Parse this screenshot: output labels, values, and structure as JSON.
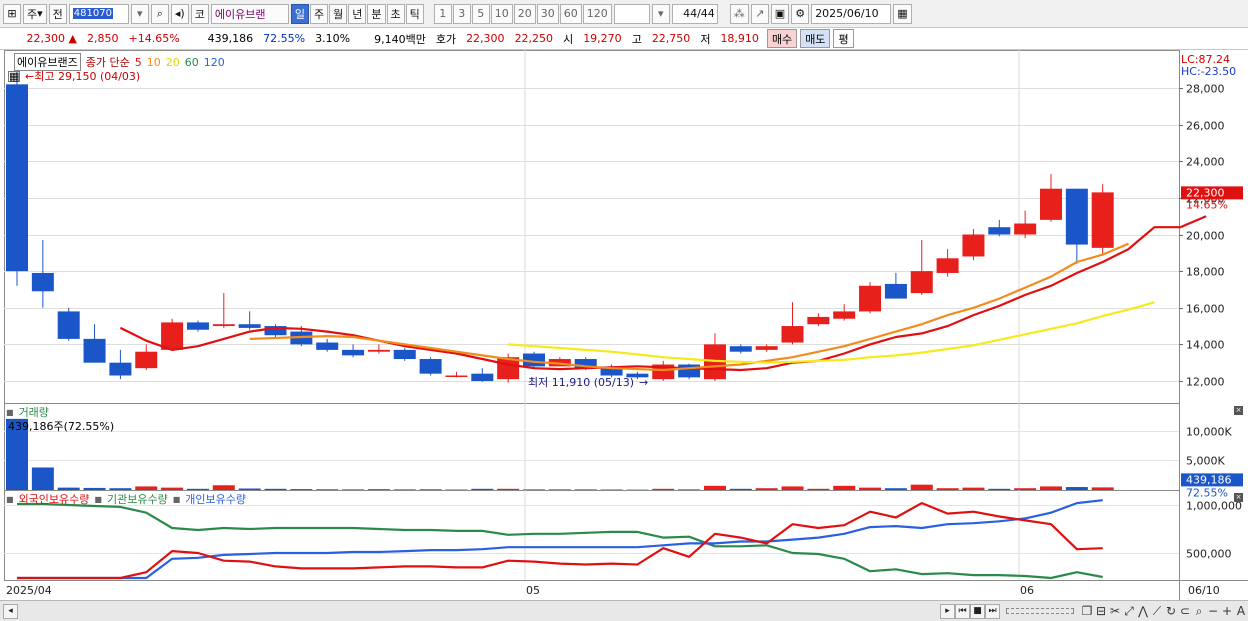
{
  "toolbar": {
    "market_label": "주",
    "prev_label": "전",
    "stock_code": "481070",
    "exchange_label": "코",
    "stock_name": "에이유브랜",
    "periods": [
      "일",
      "주",
      "월",
      "년",
      "분",
      "초",
      "틱"
    ],
    "selected_period": "일",
    "intervals": [
      "1",
      "3",
      "5",
      "10",
      "20",
      "30",
      "60",
      "120"
    ],
    "counter": "44/44",
    "date": "2025/06/10"
  },
  "quote": {
    "price": "22,300",
    "change_arrow": "▲",
    "change": "2,850",
    "change_pct": "+14.65%",
    "volume": "439,186",
    "volume_ratio": "72.55%",
    "turnover": "3.10%",
    "amount": "9,140백만",
    "ask_label": "호가",
    "ask": "22,300",
    "bid": "22,250",
    "open_label": "시",
    "open": "19,270",
    "high_label": "고",
    "high": "22,750",
    "low_label": "저",
    "low": "18,910",
    "buy_label": "매수",
    "sell_label": "매도",
    "eval_label": "평"
  },
  "price_panel": {
    "name": "에이유브랜즈",
    "ma_label": "종가 단순",
    "ma_periods": [
      "5",
      "10",
      "20",
      "60",
      "120"
    ],
    "high_annotation": "←최고 29,150 (04/03)",
    "low_annotation": "최저 11,910 (05/13)",
    "lc_label": "LC:87.24",
    "hc_label": "HC:-23.50",
    "current_price_tag": "22,300",
    "current_pct_tag": "14.65%",
    "y_ticks": [
      "28,000",
      "26,000",
      "24,000",
      "22,000",
      "20,000",
      "18,000",
      "16,000",
      "14,000",
      "12,000"
    ]
  },
  "volume_panel": {
    "title": "거래량",
    "info": "439,186주(72.55%)",
    "y_ticks": [
      "10,000K",
      "5,000K"
    ],
    "current_tag": "439,186",
    "current_pct": "72.55%"
  },
  "holdings_panel": {
    "series_labels": [
      "외국인보유수량",
      "기관보유수량",
      "개인보유수량"
    ],
    "y_ticks": [
      "1,000,000",
      "500,000"
    ]
  },
  "x_axis": {
    "labels": [
      "2025/04",
      "05",
      "06",
      "06/10"
    ]
  },
  "colors": {
    "up": "#e8201c",
    "down": "#1a56c8",
    "ma5": "#e01010",
    "ma10": "#f28c1e",
    "ma20": "#f5ea1b",
    "foreign": "#e01010",
    "institution": "#2a8a4a",
    "individual": "#2a5fe0"
  },
  "chart_data": {
    "type": "candlestick",
    "ylim": [
      11000,
      29300
    ],
    "candles": [
      {
        "o": 28200,
        "h": 29150,
        "l": 17200,
        "c": 18000
      },
      {
        "o": 17900,
        "h": 19700,
        "l": 16000,
        "c": 16900
      },
      {
        "o": 15800,
        "h": 16000,
        "l": 14200,
        "c": 14300
      },
      {
        "o": 14300,
        "h": 15100,
        "l": 13000,
        "c": 13000
      },
      {
        "o": 13000,
        "h": 13700,
        "l": 12100,
        "c": 12300
      },
      {
        "o": 12700,
        "h": 14000,
        "l": 12600,
        "c": 13600
      },
      {
        "o": 13700,
        "h": 15400,
        "l": 13700,
        "c": 15200
      },
      {
        "o": 15200,
        "h": 15300,
        "l": 14700,
        "c": 14800
      },
      {
        "o": 15000,
        "h": 16800,
        "l": 14900,
        "c": 15100
      },
      {
        "o": 15100,
        "h": 15800,
        "l": 14800,
        "c": 14900
      },
      {
        "o": 15000,
        "h": 15100,
        "l": 14400,
        "c": 14500
      },
      {
        "o": 14700,
        "h": 15000,
        "l": 13900,
        "c": 14000
      },
      {
        "o": 14100,
        "h": 14300,
        "l": 13600,
        "c": 13700
      },
      {
        "o": 13700,
        "h": 14000,
        "l": 13300,
        "c": 13400
      },
      {
        "o": 13600,
        "h": 14000,
        "l": 13500,
        "c": 13700
      },
      {
        "o": 13700,
        "h": 13800,
        "l": 13100,
        "c": 13200
      },
      {
        "o": 13200,
        "h": 13300,
        "l": 12300,
        "c": 12400
      },
      {
        "o": 12300,
        "h": 12500,
        "l": 12200,
        "c": 12300
      },
      {
        "o": 12400,
        "h": 12700,
        "l": 11950,
        "c": 12000
      },
      {
        "o": 12100,
        "h": 13500,
        "l": 11910,
        "c": 13300
      },
      {
        "o": 13500,
        "h": 13600,
        "l": 12700,
        "c": 12800
      },
      {
        "o": 12800,
        "h": 13300,
        "l": 12800,
        "c": 13200
      },
      {
        "o": 13200,
        "h": 13300,
        "l": 12600,
        "c": 12700
      },
      {
        "o": 12800,
        "h": 12900,
        "l": 12200,
        "c": 12300
      },
      {
        "o": 12400,
        "h": 12500,
        "l": 12100,
        "c": 12200
      },
      {
        "o": 12100,
        "h": 13100,
        "l": 12000,
        "c": 12900
      },
      {
        "o": 12900,
        "h": 12950,
        "l": 12100,
        "c": 12200
      },
      {
        "o": 12100,
        "h": 14600,
        "l": 12000,
        "c": 14000
      },
      {
        "o": 13900,
        "h": 14000,
        "l": 13500,
        "c": 13600
      },
      {
        "o": 13700,
        "h": 14000,
        "l": 13600,
        "c": 13900
      },
      {
        "o": 14100,
        "h": 16300,
        "l": 14000,
        "c": 15000
      },
      {
        "o": 15100,
        "h": 15700,
        "l": 15000,
        "c": 15500
      },
      {
        "o": 15400,
        "h": 16200,
        "l": 15300,
        "c": 15800
      },
      {
        "o": 15800,
        "h": 17400,
        "l": 15700,
        "c": 17200
      },
      {
        "o": 17300,
        "h": 17900,
        "l": 16500,
        "c": 16500
      },
      {
        "o": 16800,
        "h": 19700,
        "l": 16700,
        "c": 18000
      },
      {
        "o": 17900,
        "h": 19200,
        "l": 17700,
        "c": 18700
      },
      {
        "o": 18800,
        "h": 20300,
        "l": 18600,
        "c": 20000
      },
      {
        "o": 20400,
        "h": 20800,
        "l": 19900,
        "c": 20000
      },
      {
        "o": 20000,
        "h": 21300,
        "l": 19800,
        "c": 20600
      },
      {
        "o": 20800,
        "h": 23300,
        "l": 20700,
        "c": 22500
      },
      {
        "o": 22500,
        "h": 22500,
        "l": 18400,
        "c": 19450
      },
      {
        "o": 19270,
        "h": 22750,
        "l": 18910,
        "c": 22300
      }
    ],
    "ma_series": [
      {
        "period": 5,
        "start": 4,
        "values": [
          14900,
          14200,
          13700,
          13900,
          14300,
          14700,
          14900,
          14850,
          14700,
          14500,
          14200,
          13900,
          13700,
          13500,
          13200,
          12900,
          12700,
          12650,
          12700,
          12750,
          12800,
          12750,
          12700,
          12650,
          12600,
          12700,
          13000,
          13100,
          13500,
          14000,
          14400,
          14600,
          15000,
          15600,
          16100,
          16700,
          17200,
          17900,
          18500,
          19200,
          20400,
          20400,
          21000
        ]
      },
      {
        "period": 10,
        "start": 9,
        "values": [
          14300,
          14350,
          14400,
          14450,
          14400,
          14200,
          14000,
          13800,
          13600,
          13400,
          13200,
          13050,
          12950,
          12800,
          12700,
          12650,
          12600,
          12700,
          12800,
          12900,
          13100,
          13300,
          13600,
          13900,
          14300,
          14700,
          15100,
          15600,
          16000,
          16500,
          17100,
          17700,
          18500,
          18900,
          19500
        ]
      },
      {
        "period": 20,
        "start": 19,
        "values": [
          14000,
          13900,
          13800,
          13700,
          13600,
          13450,
          13300,
          13200,
          13100,
          13050,
          13000,
          13050,
          13100,
          13150,
          13300,
          13400,
          13550,
          13750,
          13950,
          14250,
          14550,
          14850,
          15150,
          15550,
          15900,
          16300
        ]
      }
    ],
    "volume_k": [
      12000,
      3800,
      400,
      350,
      300,
      600,
      400,
      200,
      800,
      250,
      200,
      150,
      120,
      100,
      150,
      100,
      120,
      80,
      200,
      200,
      100,
      110,
      100,
      80,
      60,
      200,
      100,
      700,
      200,
      300,
      600,
      200,
      700,
      400,
      300,
      900,
      300,
      400,
      200,
      300,
      600,
      500,
      439
    ],
    "holdings": {
      "foreign": [
        60000,
        60000,
        70000,
        70000,
        150000,
        300000,
        520000,
        500000,
        420000,
        410000,
        360000,
        340000,
        340000,
        340000,
        350000,
        360000,
        360000,
        350000,
        350000,
        420000,
        410000,
        390000,
        380000,
        390000,
        380000,
        550000,
        460000,
        700000,
        660000,
        600000,
        800000,
        760000,
        790000,
        930000,
        870000,
        1020000,
        910000,
        930000,
        880000,
        840000,
        800000,
        540000,
        550000
      ],
      "institution": [
        1010000,
        1010000,
        1000000,
        990000,
        980000,
        920000,
        760000,
        740000,
        760000,
        750000,
        760000,
        760000,
        760000,
        760000,
        750000,
        740000,
        740000,
        730000,
        730000,
        690000,
        700000,
        700000,
        710000,
        720000,
        720000,
        660000,
        670000,
        570000,
        570000,
        580000,
        500000,
        490000,
        440000,
        310000,
        330000,
        280000,
        290000,
        270000,
        270000,
        260000,
        220000,
        300000,
        250000
      ],
      "individual": [
        30000,
        40000,
        50000,
        60000,
        100000,
        220000,
        440000,
        450000,
        480000,
        490000,
        500000,
        500000,
        500000,
        510000,
        510000,
        520000,
        530000,
        530000,
        540000,
        560000,
        560000,
        560000,
        560000,
        560000,
        560000,
        580000,
        600000,
        600000,
        620000,
        620000,
        640000,
        660000,
        700000,
        770000,
        780000,
        760000,
        800000,
        810000,
        830000,
        860000,
        920000,
        1020000,
        1050000
      ]
    }
  }
}
